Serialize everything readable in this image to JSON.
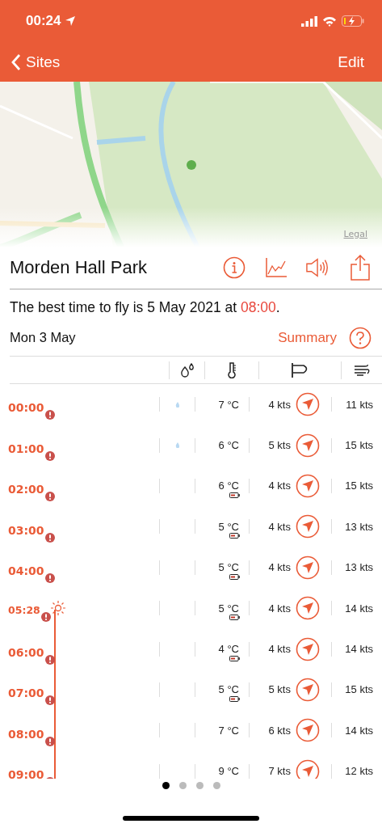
{
  "status_bar": {
    "time": "00:24"
  },
  "nav": {
    "back": "Sites",
    "edit": "Edit"
  },
  "map": {
    "kind": "picture",
    "legal": "Legal"
  },
  "site": {
    "title": "Morden Hall Park"
  },
  "best_time": {
    "text": "The best time to fly is 5 May 2021 at ",
    "time": "08:00",
    "end": "."
  },
  "day": {
    "date": "Mon 3 May",
    "summary": "Summary"
  },
  "rows": [
    {
      "kind": "hour",
      "time": "00:00",
      "warning": true,
      "rain": true,
      "temp": "7 °C",
      "cold": false,
      "wind": "4 kts",
      "gust": "11 kts"
    },
    {
      "kind": "hour",
      "time": "01:00",
      "warning": true,
      "rain": true,
      "temp": "6 °C",
      "cold": false,
      "wind": "5 kts",
      "gust": "15 kts"
    },
    {
      "kind": "hour",
      "time": "02:00",
      "warning": true,
      "rain": false,
      "temp": "6 °C",
      "cold": true,
      "wind": "4 kts",
      "gust": "15 kts"
    },
    {
      "kind": "hour",
      "time": "03:00",
      "warning": true,
      "rain": false,
      "temp": "5 °C",
      "cold": true,
      "wind": "4 kts",
      "gust": "13 kts"
    },
    {
      "kind": "hour",
      "time": "04:00",
      "warning": true,
      "rain": false,
      "temp": "5 °C",
      "cold": true,
      "wind": "4 kts",
      "gust": "13 kts"
    },
    {
      "kind": "sunrise",
      "time": "05:28",
      "warning": true,
      "rain": false,
      "temp": "5 °C",
      "cold": true,
      "wind": "4 kts",
      "gust": "14 kts"
    },
    {
      "kind": "hour",
      "time": "06:00",
      "warning": true,
      "rain": false,
      "temp": "4 °C",
      "cold": true,
      "wind": "4 kts",
      "gust": "14 kts"
    },
    {
      "kind": "hour",
      "time": "07:00",
      "warning": true,
      "rain": false,
      "temp": "5 °C",
      "cold": true,
      "wind": "5 kts",
      "gust": "15 kts"
    },
    {
      "kind": "hour",
      "time": "08:00",
      "warning": true,
      "rain": false,
      "temp": "7 °C",
      "cold": false,
      "wind": "6 kts",
      "gust": "14 kts"
    },
    {
      "kind": "hour",
      "time": "09:00",
      "warning": true,
      "rain": false,
      "temp": "9 °C",
      "cold": false,
      "wind": "7 kts",
      "gust": "12 kts"
    }
  ],
  "pages": [
    {
      "selected": true
    },
    {
      "selected": false
    },
    {
      "selected": false
    },
    {
      "selected": false
    }
  ]
}
